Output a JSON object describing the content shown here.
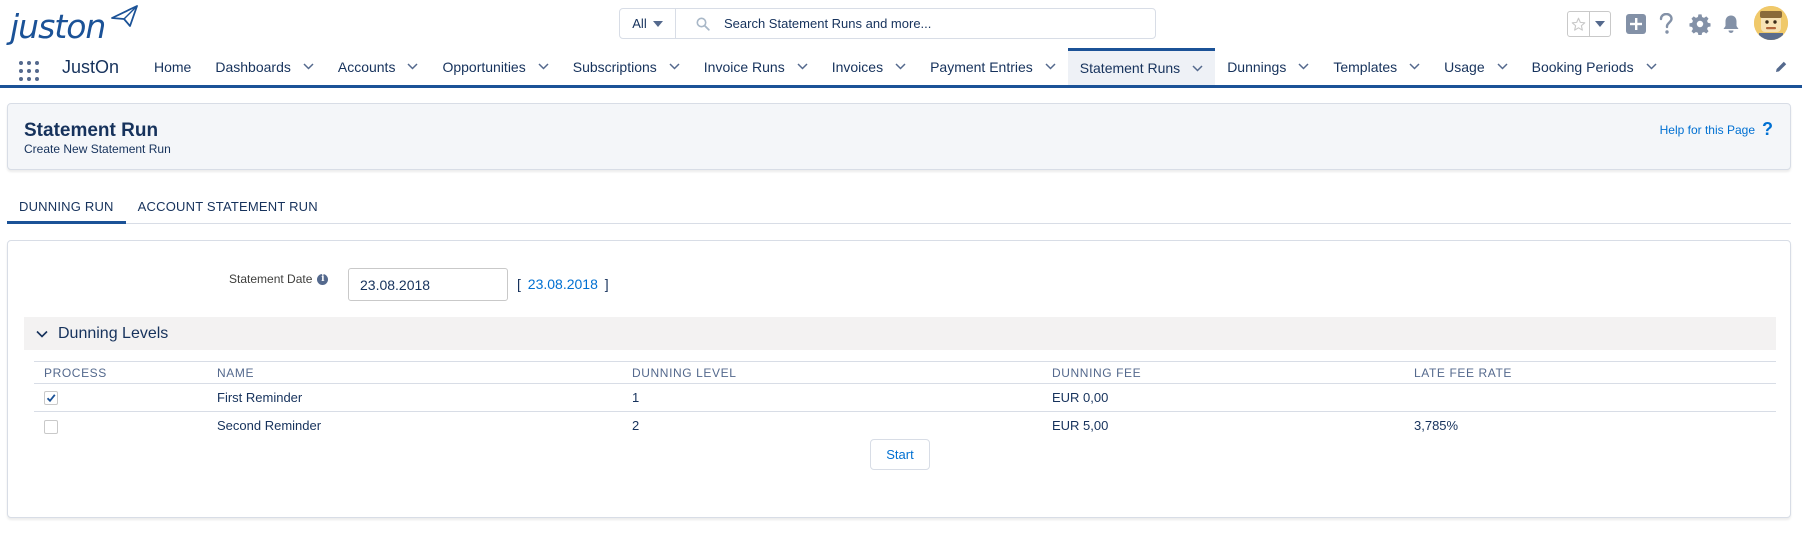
{
  "header": {
    "logo_text": "juston",
    "search_scope": "All",
    "search_placeholder": "Search Statement Runs and more..."
  },
  "nav": {
    "app_name": "JustOn",
    "items": [
      {
        "label": "Home",
        "has_menu": false
      },
      {
        "label": "Dashboards",
        "has_menu": true
      },
      {
        "label": "Accounts",
        "has_menu": true
      },
      {
        "label": "Opportunities",
        "has_menu": true
      },
      {
        "label": "Subscriptions",
        "has_menu": true
      },
      {
        "label": "Invoice Runs",
        "has_menu": true
      },
      {
        "label": "Invoices",
        "has_menu": true
      },
      {
        "label": "Payment Entries",
        "has_menu": true
      },
      {
        "label": "Statement Runs",
        "has_menu": true,
        "active": true
      },
      {
        "label": "Dunnings",
        "has_menu": true
      },
      {
        "label": "Templates",
        "has_menu": true
      },
      {
        "label": "Usage",
        "has_menu": true
      },
      {
        "label": "Booking Periods",
        "has_menu": true
      }
    ]
  },
  "page_header": {
    "title": "Statement Run",
    "subtitle": "Create New Statement Run",
    "help_label": "Help for this Page",
    "help_glyph": "?"
  },
  "tabs": [
    {
      "label": "DUNNING RUN",
      "active": true
    },
    {
      "label": "ACCOUNT STATEMENT RUN",
      "active": false
    }
  ],
  "form": {
    "statement_date_label": "Statement Date",
    "statement_date_value": "23.08.2018",
    "statement_date_link": "23.08.2018",
    "bracket_open": "[",
    "bracket_close": "]"
  },
  "dunning_levels": {
    "section_title": "Dunning Levels",
    "columns": [
      "PROCESS",
      "NAME",
      "DUNNING LEVEL",
      "DUNNING FEE",
      "LATE FEE RATE"
    ],
    "rows": [
      {
        "process": true,
        "name": "First Reminder",
        "level": "1",
        "fee": "EUR 0,00",
        "late_fee_rate": ""
      },
      {
        "process": false,
        "name": "Second Reminder",
        "level": "2",
        "fee": "EUR 5,00",
        "late_fee_rate": "3,785%"
      }
    ]
  },
  "actions": {
    "start_label": "Start"
  },
  "colors": {
    "brand": "#1b5297",
    "link": "#0070d2",
    "text": "#16325c"
  }
}
